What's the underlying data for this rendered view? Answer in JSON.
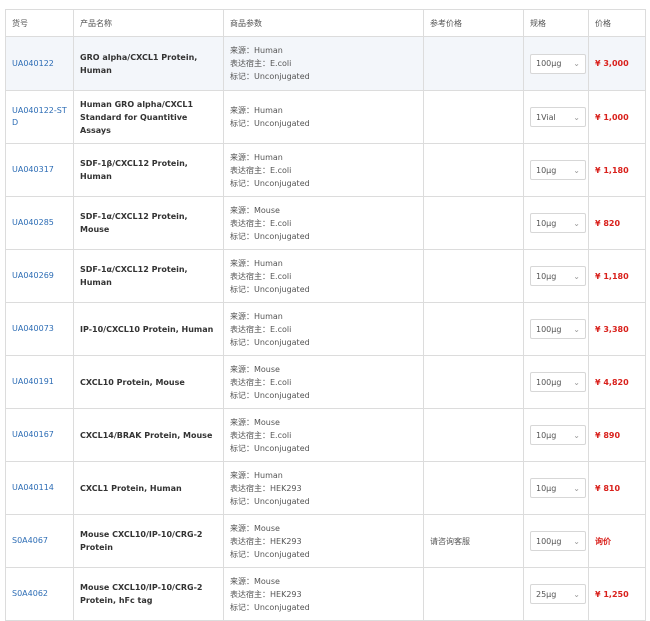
{
  "headers": {
    "code": "货号",
    "name": "产品名称",
    "params": "商品参数",
    "ref": "参考价格",
    "spec": "规格",
    "price": "价格"
  },
  "rows": [
    {
      "code": "UA040122",
      "name": "GRO alpha/CXCL1 Protein, Human",
      "source": "来源：Human",
      "host": "表达宿主：E.coli",
      "tag": "标记：Unconjugated",
      "ref": "",
      "spec": "100μg",
      "price": "¥ 3,000"
    },
    {
      "code": "UA040122-STD",
      "name": "Human GRO alpha/CXCL1 Standard for Quantitive Assays",
      "source": "来源：Human",
      "host": "",
      "tag": "标记：Unconjugated",
      "ref": "",
      "spec": "1Vial",
      "price": "¥ 1,000"
    },
    {
      "code": "UA040317",
      "name": "SDF-1β/CXCL12 Protein, Human",
      "source": "来源：Human",
      "host": "表达宿主：E.coli",
      "tag": "标记：Unconjugated",
      "ref": "",
      "spec": "10μg",
      "price": "¥ 1,180"
    },
    {
      "code": "UA040285",
      "name": "SDF-1α/CXCL12 Protein, Mouse",
      "source": "来源：Mouse",
      "host": "表达宿主：E.coli",
      "tag": "标记：Unconjugated",
      "ref": "",
      "spec": "10μg",
      "price": "¥ 820"
    },
    {
      "code": "UA040269",
      "name": "SDF-1α/CXCL12 Protein, Human",
      "source": "来源：Human",
      "host": "表达宿主：E.coli",
      "tag": "标记：Unconjugated",
      "ref": "",
      "spec": "10μg",
      "price": "¥ 1,180"
    },
    {
      "code": "UA040073",
      "name": "IP-10/CXCL10 Protein, Human",
      "source": "来源：Human",
      "host": "表达宿主：E.coli",
      "tag": "标记：Unconjugated",
      "ref": "",
      "spec": "100μg",
      "price": "¥ 3,380"
    },
    {
      "code": "UA040191",
      "name": "CXCL10 Protein, Mouse",
      "source": "来源：Mouse",
      "host": "表达宿主：E.coli",
      "tag": "标记：Unconjugated",
      "ref": "",
      "spec": "100μg",
      "price": "¥ 4,820"
    },
    {
      "code": "UA040167",
      "name": "CXCL14/BRAK Protein, Mouse",
      "source": "来源：Mouse",
      "host": "表达宿主：E.coli",
      "tag": "标记：Unconjugated",
      "ref": "",
      "spec": "10μg",
      "price": "¥ 890"
    },
    {
      "code": "UA040114",
      "name": "CXCL1 Protein, Human",
      "source": "来源：Human",
      "host": "表达宿主：HEK293",
      "tag": "标记：Unconjugated",
      "ref": "",
      "spec": "10μg",
      "price": "¥ 810"
    },
    {
      "code": "S0A4067",
      "name": "Mouse CXCL10/IP-10/CRG-2 Protein",
      "source": "来源：Mouse",
      "host": "表达宿主：HEK293",
      "tag": "标记：Unconjugated",
      "ref": "请咨询客服",
      "spec": "100μg",
      "price": "询价"
    },
    {
      "code": "S0A4062",
      "name": "Mouse CXCL10/IP-10/CRG-2 Protein, hFc tag",
      "source": "来源：Mouse",
      "host": "表达宿主：HEK293",
      "tag": "标记：Unconjugated",
      "ref": "",
      "spec": "25μg",
      "price": "¥ 1,250"
    }
  ]
}
